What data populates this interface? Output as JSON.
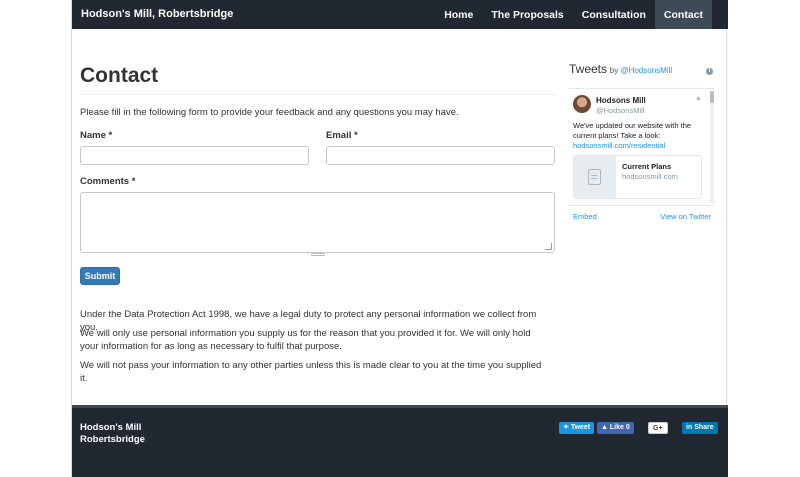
{
  "nav": {
    "brand": "Hodson's Mill, Robertsbridge",
    "items": [
      {
        "label": "Home",
        "active": false
      },
      {
        "label": "The Proposals",
        "active": false
      },
      {
        "label": "Consultation",
        "active": false
      },
      {
        "label": "Contact",
        "active": true
      }
    ]
  },
  "main": {
    "title": "Contact",
    "intro": "Please fill in the following form to provide your feedback and any questions you may have.",
    "form": {
      "name_label": "Name *",
      "email_label": "Email *",
      "comments_label": "Comments *",
      "name_value": "",
      "email_value": "",
      "comments_value": "",
      "submit_label": "Submit"
    },
    "paragraphs": [
      "Under the Data Protection Act 1998, we have a legal duty to protect any personal information we collect from you.",
      "We will only use personal information you supply us for the reason that you provided it for. We will only hold your information for as long as necessary to fulfil that purpose.",
      "We will not pass your information to any other parties unless this is made clear to you at the time you supplied it."
    ]
  },
  "twitter": {
    "title": "Tweets",
    "by": "by",
    "handle_link": "@HodsonsMill",
    "tweet": {
      "name": "Hodsons Mill",
      "handle": "@HodsonsMill",
      "text": "We've updated our website with the current plans! Take a look:",
      "link": "hodsonsmill.com/residential",
      "card_title": "Current Plans",
      "card_url": "hodsonsmill.com"
    },
    "embed": "Embed",
    "view": "View on Twitter"
  },
  "footer": {
    "line1": "Hodson's Mill",
    "line2": "Robertsbridge",
    "tweet_btn": "Tweet",
    "like_btn": "Like 0",
    "gplus_btn": "G+",
    "linkedin_btn": "Share"
  }
}
